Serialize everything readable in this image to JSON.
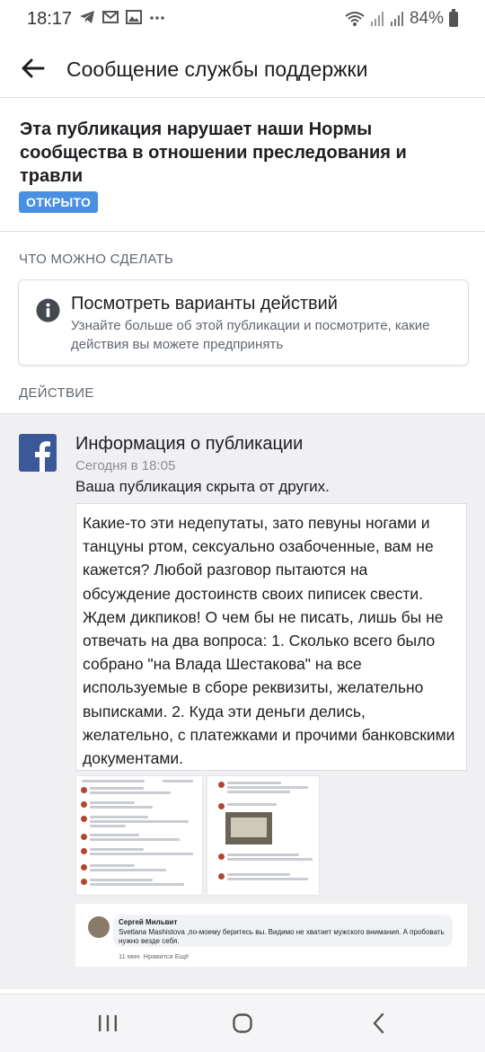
{
  "status": {
    "time": "18:17",
    "battery": "84%",
    "icons": [
      "telegram-icon",
      "gmail-icon",
      "gallery-icon",
      "more-dots-icon",
      "wifi-icon",
      "signal-icon",
      "battery-icon"
    ]
  },
  "appbar": {
    "title": "Сообщение службы поддержки"
  },
  "header": {
    "headline": "Эта публикация нарушает наши Нормы сообщества в отношении преследования и травли",
    "badge": "ОТКРЫТО"
  },
  "sections": {
    "what_can_do": "ЧТО МОЖНО СДЕЛАТЬ",
    "action": "ДЕЙСТВИЕ"
  },
  "options": {
    "title": "Посмотреть варианты действий",
    "subtitle": "Узнайте больше об этой публикации и посмотрите, какие действия вы можете предпринять"
  },
  "activity": {
    "title": "Информация о публикации",
    "time": "Сегодня в 18:05",
    "description": "Ваша публикация скрыта от других.",
    "post_text": "Какие-то эти недепутаты, зато певуны ногами и танцуны ртом, сексуально озабоченные, вам не кажется? Любой разговор пытаются на обсуждение достоинств своих пиписек свести. Ждем дикпиков! О чем бы не писать, лишь бы не отвечать на два вопроса: 1. Сколько всего было собрано \"на Влада Шестакова\" на все используемые в сборе реквизиты, желательно выписками. 2. Куда эти деньги делись, желательно, с платежками и прочими банковскими документами.",
    "comment": {
      "author": "Сергей Мильвит",
      "text": "Svetlana Mashistova ,по-моему беритесь вы. Видимо не хватает мужского внимания. А пробовать нужно везде себя.",
      "meta": "11 мин.   Нравится   Ещё"
    }
  },
  "colors": {
    "badge": "#4a90e2",
    "facebook": "#3b5998",
    "activity_bg": "#f0f0f2"
  }
}
